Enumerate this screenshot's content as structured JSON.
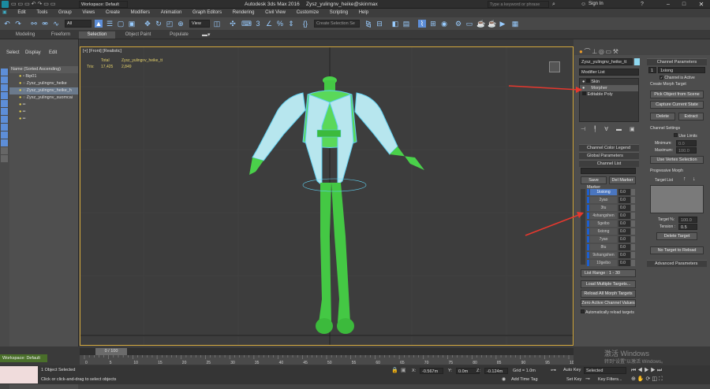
{
  "titlebar": {
    "workspace": "Workspace: Default",
    "app_title": "Autodesk 3ds Max 2016",
    "file": "Zysz_yulingnv_heike@skinmax",
    "search_placeholder": "Type a keyword or phrase",
    "signin": "Sign In"
  },
  "menu": [
    "Edit",
    "Tools",
    "Group",
    "Views",
    "Create",
    "Modifiers",
    "Animation",
    "Graph Editors",
    "Rendering",
    "Civil View",
    "Customize",
    "Scripting",
    "Help"
  ],
  "toolbar": {
    "filter_value": "All",
    "view_value": "View",
    "selection_set_placeholder": "Create Selection Se"
  },
  "ribbon_tabs": [
    "Modeling",
    "Freeform",
    "Selection",
    "Object Paint",
    "Populate"
  ],
  "ribbon_active": "Selection",
  "scene_explorer": {
    "tabs": [
      "Select",
      "Display",
      "Edit"
    ],
    "header": "Name (Sorted Ascending)",
    "items": [
      "Bip01",
      "Zysz_yulingnv_heike",
      "Zysz_yulingnv_heike_h",
      "Zysz_yulingnv_suomcai"
    ]
  },
  "viewport": {
    "label": "[+] [Front] [Realistic]",
    "stats_header_total": "Total",
    "stats_header_obj": "Zysz_yulingnv_heike_tt",
    "stats_label": "Tris:",
    "stats_total": "17,425",
    "stats_obj": "2,849"
  },
  "modifier_panel": {
    "object_name": "Zysz_yulingnv_heike_tt",
    "modifier_list": "Modifier List",
    "stack": [
      "Skin",
      "Morpher",
      "Editable Poly"
    ],
    "selected": "Morpher"
  },
  "rollouts_left": {
    "channel_color_legend": "Channel Color Legend",
    "global_parameters": "Global Parameters",
    "channel_list": "Channel List",
    "save_marker": "Save Marker",
    "del_marker": "Del Marker",
    "list_range": "List Range :     1 - 30",
    "load_multiple": "Load Multiple Targets...",
    "reload_all": "Reload All Morph Targets",
    "zero_active": "Zero Active Channel Values",
    "auto_reload": "Automatically reload targets"
  },
  "channels": [
    {
      "name": "1kxiong",
      "value": "0.0",
      "active": true
    },
    {
      "name": "2yao",
      "value": "0.0",
      "active": true
    },
    {
      "name": "3tu",
      "value": "0.0",
      "active": true
    },
    {
      "name": "4shangshen",
      "value": "0.0",
      "active": true
    },
    {
      "name": "5geibo",
      "value": "0.0",
      "active": true
    },
    {
      "name": "6xiong",
      "value": "0.0",
      "active": true
    },
    {
      "name": "7yao",
      "value": "0.0",
      "active": true
    },
    {
      "name": "8tu",
      "value": "0.0",
      "active": true
    },
    {
      "name": "9shangshen",
      "value": "0.0",
      "active": true
    },
    {
      "name": "10geibo",
      "value": "0.0",
      "active": true
    }
  ],
  "channel_params": {
    "title": "Channel Parameters",
    "channel_num": "1",
    "channel_name": "1xiong",
    "channel_active": "Channel is Active",
    "create_target": "Create Morph Target",
    "pick_object": "Pick Object from Scene",
    "capture_state": "Capture Current State",
    "delete": "Delete",
    "extract": "Extract",
    "settings_title": "Channel Settings",
    "use_limits": "Use Limits",
    "minimum_label": "Minimum:",
    "minimum_value": "0.0",
    "maximum_label": "Maximum:",
    "maximum_value": "100.0",
    "use_vertex": "Use Vertex Selection",
    "progressive_title": "Progressive Morph",
    "target_list": "Target List",
    "target_pct_label": "Target %:",
    "target_pct_value": "100.0",
    "tension_label": "Tension :",
    "tension_value": "0.5",
    "delete_target": "Delete Target",
    "no_target": "No Target to Reload",
    "advanced": "Advanced Parameters"
  },
  "timeline": {
    "frame": "0 / 100",
    "ticks": [
      "0",
      "5",
      "10",
      "15",
      "20",
      "25",
      "30",
      "35",
      "40",
      "45",
      "50",
      "55",
      "60",
      "65",
      "70",
      "75",
      "80",
      "85",
      "90",
      "95",
      "100"
    ]
  },
  "status": {
    "workspace": "Workspace: Default",
    "selected": "1 Object Selected",
    "prompt": "Click or click-and-drag to select objects",
    "x_label": "X:",
    "x_value": "-0.567m",
    "y_label": "Y:",
    "y_value": "0.0m",
    "z_label": "Z:",
    "z_value": "-0.124m",
    "grid": "Grid = 1.0m",
    "add_time_tag": "Add Time Tag",
    "auto_key": "Auto Key",
    "selected_dropdown": "Selected",
    "set_key": "Set Key",
    "key_filters": "Key Filters...",
    "watermark_1": "激活 Windows",
    "watermark_2": "转到“设置”以激活 Windows。"
  }
}
